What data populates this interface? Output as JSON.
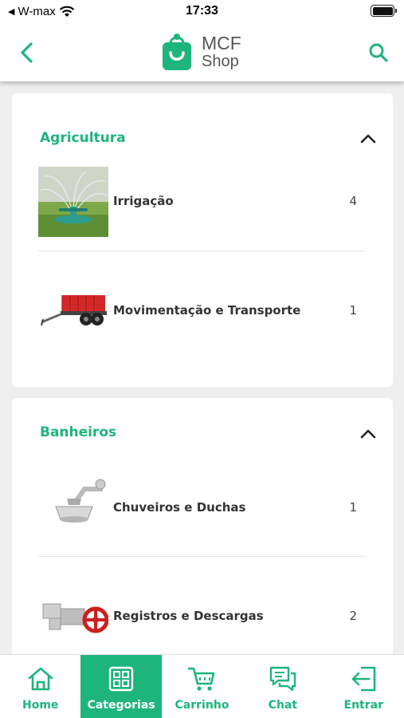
{
  "status_bar": {
    "carrier": "W-max",
    "time": "17:33"
  },
  "header": {
    "logo_line1": "MCF",
    "logo_line2": "Shop",
    "back_icon": "chevron-left-icon",
    "search_icon": "search-icon"
  },
  "colors": {
    "accent": "#1db57c",
    "background": "#efefef",
    "card": "#ffffff",
    "text": "#333333"
  },
  "categories": [
    {
      "title": "Agricultura",
      "expanded": true,
      "items": [
        {
          "name": "Irrigação",
          "count": "4",
          "icon": "sprinkler-image"
        },
        {
          "name": "Movimentação e Transporte",
          "count": "1",
          "icon": "trailer-image"
        }
      ]
    },
    {
      "title": "Banheiros",
      "expanded": true,
      "items": [
        {
          "name": "Chuveiros e Duchas",
          "count": "1",
          "icon": "shower-image"
        },
        {
          "name": "Registros e Descargas",
          "count": "2",
          "icon": "valve-image"
        }
      ]
    }
  ],
  "bottom_nav": {
    "active": "Categorias",
    "items": [
      {
        "label": "Home",
        "icon": "home-icon"
      },
      {
        "label": "Categorias",
        "icon": "grid-icon"
      },
      {
        "label": "Carrinho",
        "icon": "cart-icon"
      },
      {
        "label": "Chat",
        "icon": "chat-icon"
      },
      {
        "label": "Entrar",
        "icon": "login-icon"
      }
    ]
  }
}
